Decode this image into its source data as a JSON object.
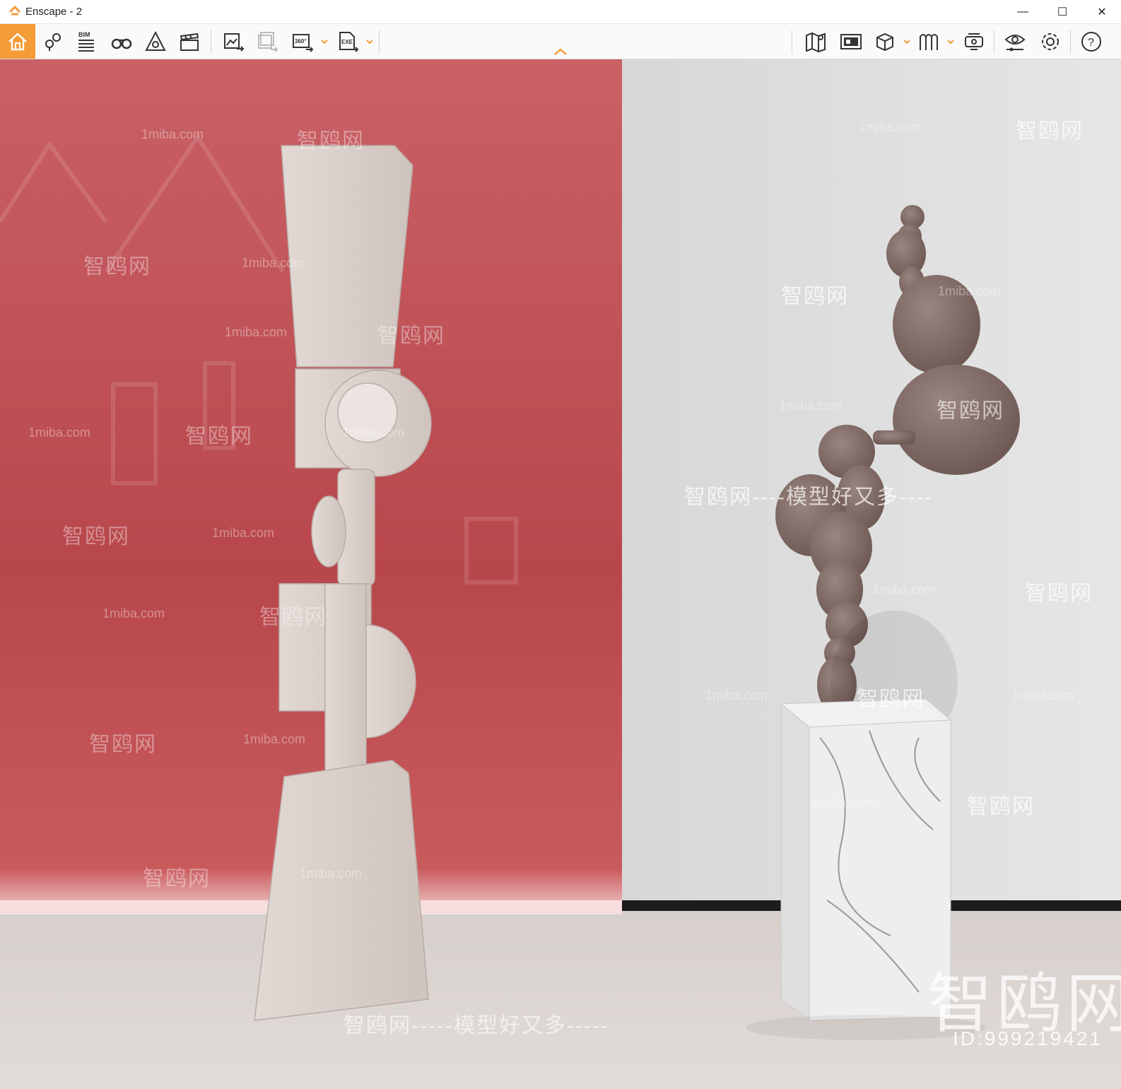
{
  "window": {
    "title": "Enscape - 2",
    "minimize_glyph": "—",
    "maximize_glyph": "☐",
    "close_glyph": "✕"
  },
  "toolbar": {
    "accent_color": "#f39c38",
    "left_items": [
      "home-icon",
      "asset-library-icon",
      "bim-icon",
      "binoculars-icon",
      "navigation-icon",
      "video-editor-icon",
      "export-image-icon",
      "batch-export-icon",
      "export-360-icon",
      "export-exe-icon"
    ],
    "right_items": [
      "map-icon",
      "image-panel-icon",
      "cube-icon",
      "views-icon",
      "vr-headset-icon",
      "visual-settings-icon",
      "settings-icon",
      "help-icon"
    ],
    "bim_label": "BIM",
    "pano_label": "360°",
    "exe_label": "EXE",
    "help_glyph": "?"
  },
  "watermarks": {
    "site": "1miba.com",
    "brand": "智鸥网",
    "slogan": "智鸥网-----模型好又多-----",
    "slogan_mid": "智鸥网----模型好又多----",
    "big_brand": "智鸥网",
    "id_text": "ID:999219421"
  }
}
